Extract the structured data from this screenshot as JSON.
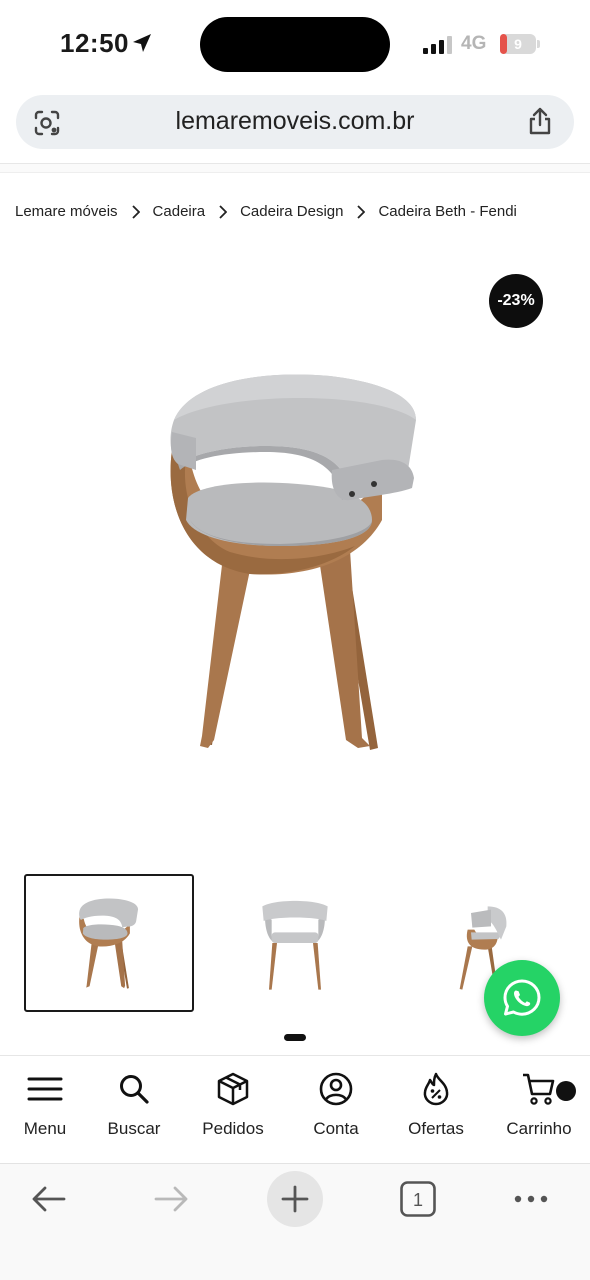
{
  "status_bar": {
    "time": "12:50",
    "network": "4G",
    "battery": "9",
    "battery_level_percent": 9,
    "battery_color": "#e5534b"
  },
  "browser": {
    "url": "lemaremoveis.com.br",
    "open_tabs": "1",
    "icons": {
      "left": "lens-icon",
      "right": "share-icon",
      "back": "back-arrow-icon",
      "forward": "forward-arrow-icon",
      "new_tab": "plus-icon",
      "tabs": "tabs-icon",
      "more": "more-icon"
    }
  },
  "breadcrumb": [
    "Lemare móveis",
    "Cadeira",
    "Cadeira Design",
    "Cadeira Beth - Fendi"
  ],
  "product": {
    "discount_badge": "-23%",
    "thumbnails": [
      "front-three-quarter",
      "front",
      "side"
    ],
    "active_thumbnail": 0
  },
  "store_nav": [
    {
      "label": "Menu",
      "icon": "menu-icon"
    },
    {
      "label": "Buscar",
      "icon": "search-icon"
    },
    {
      "label": "Pedidos",
      "icon": "box-icon"
    },
    {
      "label": "Conta",
      "icon": "user-icon"
    },
    {
      "label": "Ofertas",
      "icon": "offer-flame-icon"
    },
    {
      "label": "Carrinho",
      "icon": "cart-icon"
    }
  ],
  "colors": {
    "whatsapp": "#25d366",
    "badge": "#0d0d0d",
    "chair_wood": "#a9774d",
    "chair_upholstery": "#b7b8ba"
  }
}
